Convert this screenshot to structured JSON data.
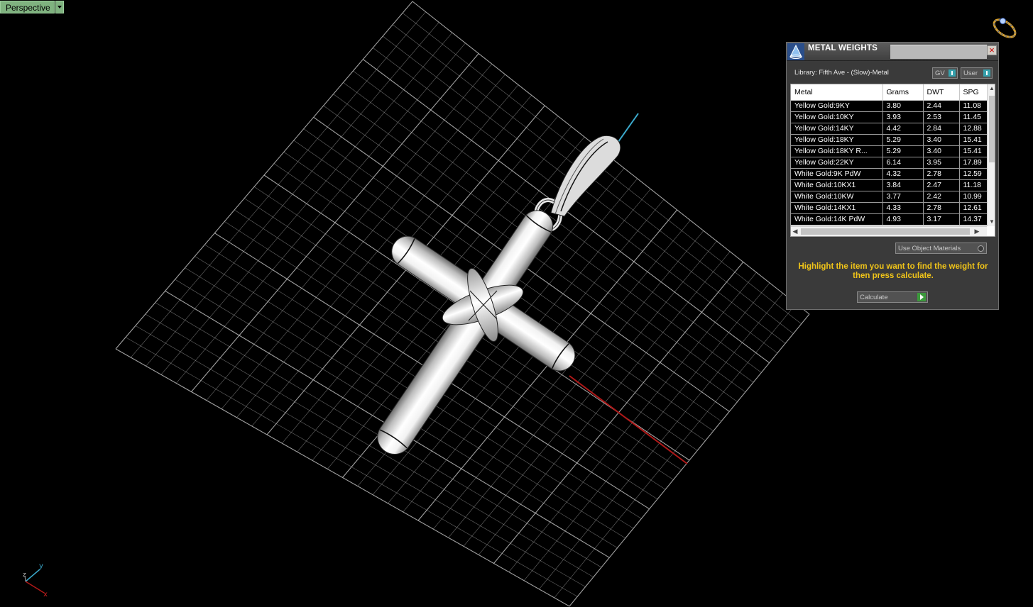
{
  "viewport": {
    "label": "Perspective",
    "axis_labels": {
      "x": "x",
      "y": "y",
      "z": "z"
    },
    "colors": {
      "grid": "#bdbdbd",
      "x_axis": "#b01818",
      "y_axis": "#3aa6c8"
    }
  },
  "panel": {
    "title": "METAL WEIGHTS",
    "library": "Library: Fifth Ave - (Slow)-Metal",
    "gv_label": "GV",
    "user_label": "User",
    "columns": [
      "Metal",
      "Grams",
      "DWT",
      "SPG"
    ],
    "rows": [
      [
        "Yellow Gold:9KY",
        "3.80",
        "2.44",
        "11.08"
      ],
      [
        "Yellow Gold:10KY",
        "3.93",
        "2.53",
        "11.45"
      ],
      [
        "Yellow Gold:14KY",
        "4.42",
        "2.84",
        "12.88"
      ],
      [
        "Yellow Gold:18KY",
        "5.29",
        "3.40",
        "15.41"
      ],
      [
        "Yellow Gold:18KY R...",
        "5.29",
        "3.40",
        "15.41"
      ],
      [
        "Yellow Gold:22KY",
        "6.14",
        "3.95",
        "17.89"
      ],
      [
        "White Gold:9K PdW",
        "4.32",
        "2.78",
        "12.59"
      ],
      [
        "White Gold:10KX1",
        "3.84",
        "2.47",
        "11.18"
      ],
      [
        "White Gold:10KW",
        "3.77",
        "2.42",
        "10.99"
      ],
      [
        "White Gold:14KX1",
        "4.33",
        "2.78",
        "12.61"
      ],
      [
        "White Gold:14K PdW",
        "4.93",
        "3.17",
        "14.37"
      ]
    ],
    "use_object_materials": "Use Object Materials",
    "hint": "Highlight the item you want to find the weight for then press calculate.",
    "calculate": "Calculate",
    "accent_color": "#f0c419"
  }
}
